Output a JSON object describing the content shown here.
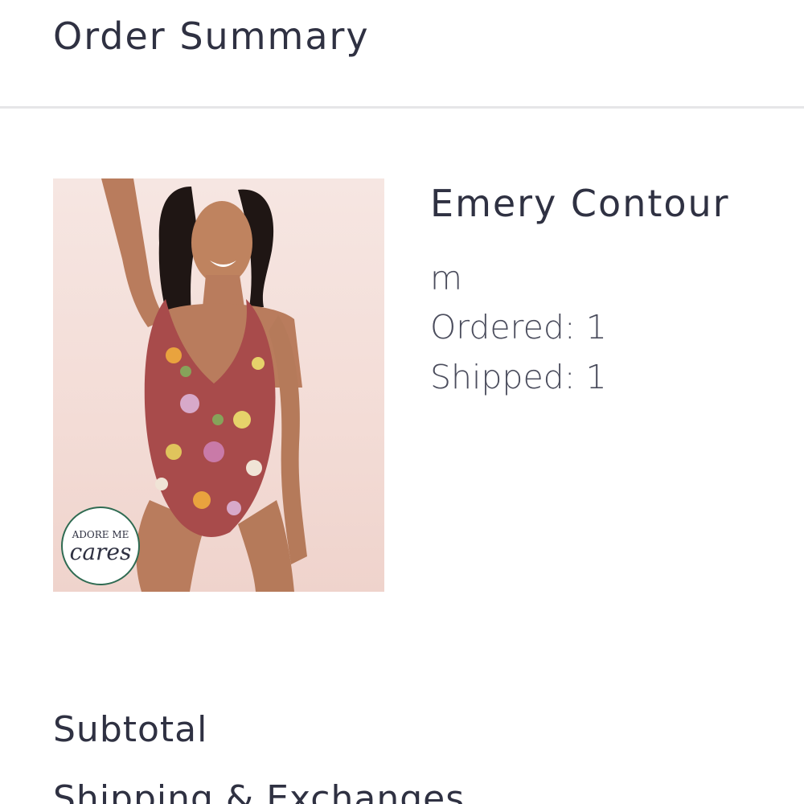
{
  "header": {
    "title": "Order Summary"
  },
  "item": {
    "name": "Emery Contour",
    "size": "m",
    "ordered": "Ordered: 1",
    "shipped": "Shipped: 1",
    "badge_top": "ADORE ME",
    "badge_bottom": "cares"
  },
  "summary": {
    "subtotal_label": "Subtotal",
    "shipping_label": "Shipping & Exchanges"
  },
  "colors": {
    "text": "#2f3142",
    "divider": "#e6e6e8",
    "badge_border": "#2f6b52"
  }
}
